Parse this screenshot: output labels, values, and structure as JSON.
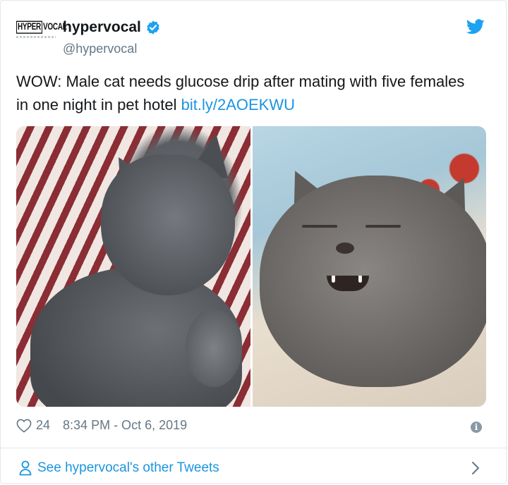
{
  "header": {
    "avatar_logo_text_a": "HYPER",
    "avatar_logo_text_b": "VOCAL",
    "display_name": "hypervocal",
    "handle": "@hypervocal",
    "verified_icon": "verified-badge-icon",
    "platform_icon": "twitter-bird-icon",
    "brand_color": "#1da1f2"
  },
  "tweet": {
    "text": "WOW: Male cat needs glucose drip after mating with five females in one night in pet hotel ",
    "link_text": "bit.ly/2AOEKWU",
    "link_color": "#1b95e0"
  },
  "media": {
    "count": 2,
    "images": [
      {
        "alt": "grey cat lying on striped bedding"
      },
      {
        "alt": "grey cat squinting with mouth open"
      }
    ]
  },
  "meta": {
    "like_icon": "heart-icon",
    "like_count": "24",
    "timestamp": "8:34 PM - Oct 6, 2019",
    "info_icon": "info-icon"
  },
  "footer": {
    "see_more_label": "See hypervocal's other Tweets",
    "person_icon": "person-icon",
    "chevron_icon": "chevron-right-icon"
  }
}
